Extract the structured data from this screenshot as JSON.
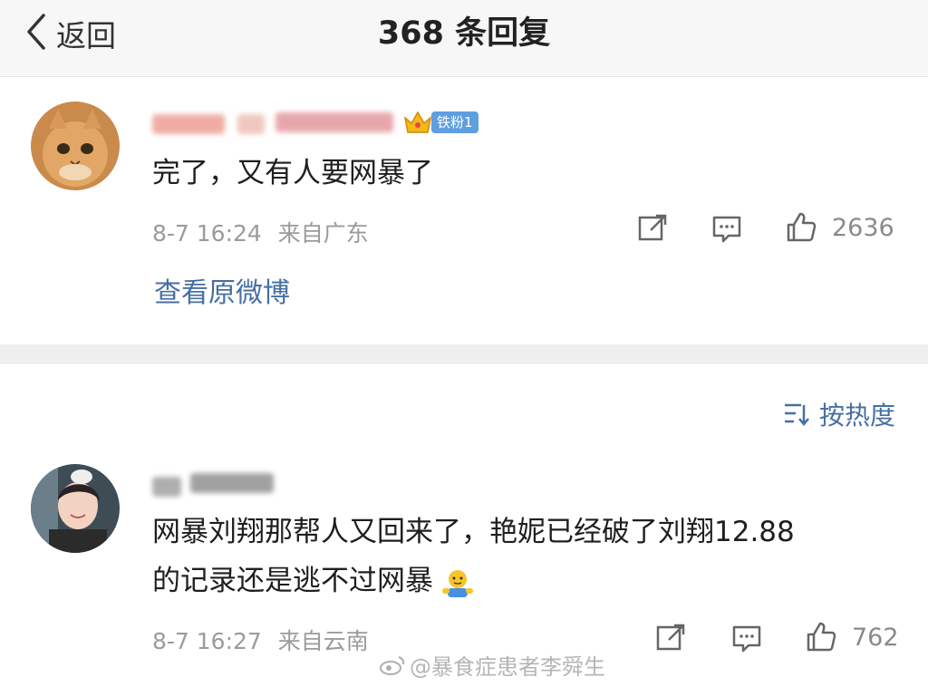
{
  "header": {
    "back_label": "返回",
    "title": "368 条回复"
  },
  "comments": [
    {
      "badge_label": "铁粉1",
      "text": "完了，又有人要网暴了",
      "timestamp": "8-7 16:24",
      "location": "来自广东",
      "like_count": "2636",
      "view_original": "查看原微博"
    },
    {
      "text_line1": "网暴刘翔那帮人又回来了，艳妮已经破了刘翔12.88",
      "text_line2": "的记录还是逃不过网暴",
      "timestamp": "8-7 16:27",
      "location": "来自云南",
      "like_count": "762"
    }
  ],
  "sort": {
    "label": "按热度"
  },
  "watermark": "@暴食症患者李舜生",
  "icons": [
    "chevron-left-icon",
    "share-icon",
    "comment-icon",
    "like-icon",
    "sort-icon",
    "crown-icon",
    "emoji-icon",
    "weibo-logo-icon"
  ],
  "colors": {
    "link": "#476fa3",
    "badge": "#5f9fe0",
    "meta": "#9b9b9b",
    "header_bg": "#f7f7f7",
    "divider": "#efefef"
  }
}
